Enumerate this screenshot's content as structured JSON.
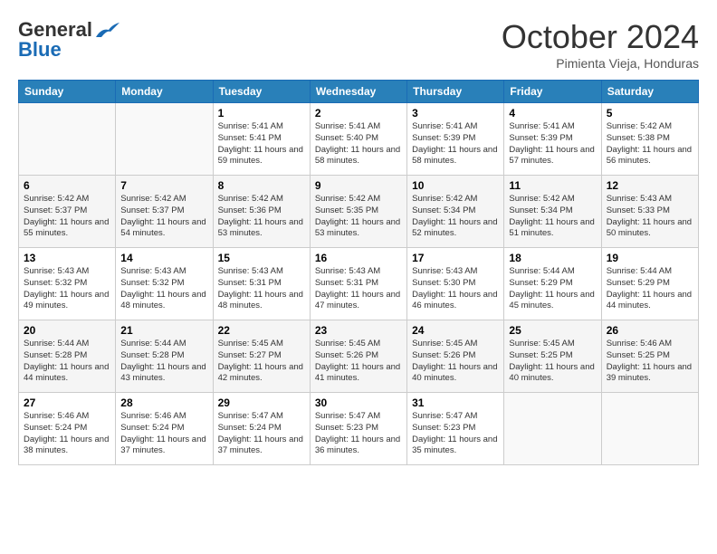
{
  "logo": {
    "general": "General",
    "blue": "Blue"
  },
  "title": {
    "month": "October 2024",
    "location": "Pimienta Vieja, Honduras"
  },
  "headers": [
    "Sunday",
    "Monday",
    "Tuesday",
    "Wednesday",
    "Thursday",
    "Friday",
    "Saturday"
  ],
  "weeks": [
    [
      {
        "day": "",
        "info": ""
      },
      {
        "day": "",
        "info": ""
      },
      {
        "day": "1",
        "info": "Sunrise: 5:41 AM\nSunset: 5:41 PM\nDaylight: 11 hours and 59 minutes."
      },
      {
        "day": "2",
        "info": "Sunrise: 5:41 AM\nSunset: 5:40 PM\nDaylight: 11 hours and 58 minutes."
      },
      {
        "day": "3",
        "info": "Sunrise: 5:41 AM\nSunset: 5:39 PM\nDaylight: 11 hours and 58 minutes."
      },
      {
        "day": "4",
        "info": "Sunrise: 5:41 AM\nSunset: 5:39 PM\nDaylight: 11 hours and 57 minutes."
      },
      {
        "day": "5",
        "info": "Sunrise: 5:42 AM\nSunset: 5:38 PM\nDaylight: 11 hours and 56 minutes."
      }
    ],
    [
      {
        "day": "6",
        "info": "Sunrise: 5:42 AM\nSunset: 5:37 PM\nDaylight: 11 hours and 55 minutes."
      },
      {
        "day": "7",
        "info": "Sunrise: 5:42 AM\nSunset: 5:37 PM\nDaylight: 11 hours and 54 minutes."
      },
      {
        "day": "8",
        "info": "Sunrise: 5:42 AM\nSunset: 5:36 PM\nDaylight: 11 hours and 53 minutes."
      },
      {
        "day": "9",
        "info": "Sunrise: 5:42 AM\nSunset: 5:35 PM\nDaylight: 11 hours and 53 minutes."
      },
      {
        "day": "10",
        "info": "Sunrise: 5:42 AM\nSunset: 5:34 PM\nDaylight: 11 hours and 52 minutes."
      },
      {
        "day": "11",
        "info": "Sunrise: 5:42 AM\nSunset: 5:34 PM\nDaylight: 11 hours and 51 minutes."
      },
      {
        "day": "12",
        "info": "Sunrise: 5:43 AM\nSunset: 5:33 PM\nDaylight: 11 hours and 50 minutes."
      }
    ],
    [
      {
        "day": "13",
        "info": "Sunrise: 5:43 AM\nSunset: 5:32 PM\nDaylight: 11 hours and 49 minutes."
      },
      {
        "day": "14",
        "info": "Sunrise: 5:43 AM\nSunset: 5:32 PM\nDaylight: 11 hours and 48 minutes."
      },
      {
        "day": "15",
        "info": "Sunrise: 5:43 AM\nSunset: 5:31 PM\nDaylight: 11 hours and 48 minutes."
      },
      {
        "day": "16",
        "info": "Sunrise: 5:43 AM\nSunset: 5:31 PM\nDaylight: 11 hours and 47 minutes."
      },
      {
        "day": "17",
        "info": "Sunrise: 5:43 AM\nSunset: 5:30 PM\nDaylight: 11 hours and 46 minutes."
      },
      {
        "day": "18",
        "info": "Sunrise: 5:44 AM\nSunset: 5:29 PM\nDaylight: 11 hours and 45 minutes."
      },
      {
        "day": "19",
        "info": "Sunrise: 5:44 AM\nSunset: 5:29 PM\nDaylight: 11 hours and 44 minutes."
      }
    ],
    [
      {
        "day": "20",
        "info": "Sunrise: 5:44 AM\nSunset: 5:28 PM\nDaylight: 11 hours and 44 minutes."
      },
      {
        "day": "21",
        "info": "Sunrise: 5:44 AM\nSunset: 5:28 PM\nDaylight: 11 hours and 43 minutes."
      },
      {
        "day": "22",
        "info": "Sunrise: 5:45 AM\nSunset: 5:27 PM\nDaylight: 11 hours and 42 minutes."
      },
      {
        "day": "23",
        "info": "Sunrise: 5:45 AM\nSunset: 5:26 PM\nDaylight: 11 hours and 41 minutes."
      },
      {
        "day": "24",
        "info": "Sunrise: 5:45 AM\nSunset: 5:26 PM\nDaylight: 11 hours and 40 minutes."
      },
      {
        "day": "25",
        "info": "Sunrise: 5:45 AM\nSunset: 5:25 PM\nDaylight: 11 hours and 40 minutes."
      },
      {
        "day": "26",
        "info": "Sunrise: 5:46 AM\nSunset: 5:25 PM\nDaylight: 11 hours and 39 minutes."
      }
    ],
    [
      {
        "day": "27",
        "info": "Sunrise: 5:46 AM\nSunset: 5:24 PM\nDaylight: 11 hours and 38 minutes."
      },
      {
        "day": "28",
        "info": "Sunrise: 5:46 AM\nSunset: 5:24 PM\nDaylight: 11 hours and 37 minutes."
      },
      {
        "day": "29",
        "info": "Sunrise: 5:47 AM\nSunset: 5:24 PM\nDaylight: 11 hours and 37 minutes."
      },
      {
        "day": "30",
        "info": "Sunrise: 5:47 AM\nSunset: 5:23 PM\nDaylight: 11 hours and 36 minutes."
      },
      {
        "day": "31",
        "info": "Sunrise: 5:47 AM\nSunset: 5:23 PM\nDaylight: 11 hours and 35 minutes."
      },
      {
        "day": "",
        "info": ""
      },
      {
        "day": "",
        "info": ""
      }
    ]
  ]
}
